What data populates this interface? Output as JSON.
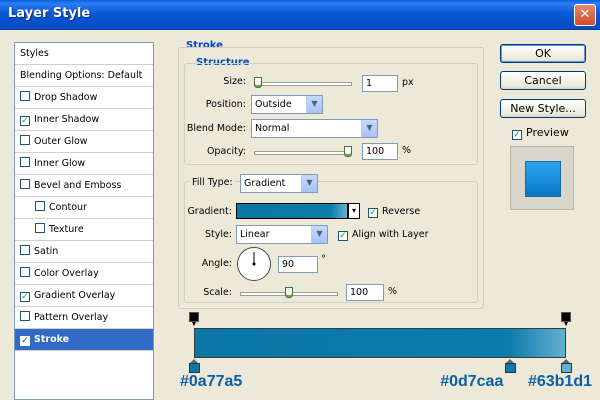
{
  "window": {
    "title": "Layer Style",
    "close_glyph": "✕"
  },
  "styles_list": {
    "header": "Styles",
    "blending": "Blending Options: Default",
    "items": [
      {
        "label": "Drop Shadow",
        "checked": false
      },
      {
        "label": "Inner Shadow",
        "checked": true
      },
      {
        "label": "Outer Glow",
        "checked": false
      },
      {
        "label": "Inner Glow",
        "checked": false
      },
      {
        "label": "Bevel and Emboss",
        "checked": false
      },
      {
        "label": "Contour",
        "checked": false
      },
      {
        "label": "Texture",
        "checked": false
      },
      {
        "label": "Satin",
        "checked": false
      },
      {
        "label": "Color Overlay",
        "checked": false
      },
      {
        "label": "Gradient Overlay",
        "checked": true
      },
      {
        "label": "Pattern Overlay",
        "checked": false
      },
      {
        "label": "Stroke",
        "checked": true
      }
    ],
    "check_glyph": "✓"
  },
  "stroke": {
    "title": "Stroke",
    "structure": {
      "title": "Structure",
      "size_label": "Size:",
      "size_value": "1",
      "size_unit": "px",
      "position_label": "Position:",
      "position_value": "Outside",
      "blend_label": "Blend Mode:",
      "blend_value": "Normal",
      "opacity_label": "Opacity:",
      "opacity_value": "100",
      "opacity_unit": "%",
      "size_level": 0.0,
      "opacity_level": 1.0
    },
    "fill": {
      "fill_type_label": "Fill Type:",
      "fill_type_value": "Gradient",
      "gradient_label": "Gradient:",
      "reverse_label": "Reverse",
      "reverse_checked": true,
      "style_label": "Style:",
      "style_value": "Linear",
      "align_label": "Align with Layer",
      "align_checked": true,
      "angle_label": "Angle:",
      "angle_value": "90",
      "angle_unit": "°",
      "scale_label": "Scale:",
      "scale_value": "100",
      "scale_unit": "%",
      "scale_level": 0.5
    }
  },
  "buttons": {
    "ok": "OK",
    "cancel": "Cancel",
    "new_style": "New Style...",
    "preview": "Preview",
    "preview_checked": true
  },
  "gradient_colors": {
    "c1": "#0a77a5",
    "c2": "#0d7caa",
    "c3": "#63b1d1"
  },
  "gradient_stops": [
    {
      "label": "#0a77a5",
      "color": "#0a77a5",
      "location": 0
    },
    {
      "label": "#0d7caa",
      "color": "#0d7caa",
      "location": 0.85
    },
    {
      "label": "#63b1d1",
      "color": "#63b1d1",
      "location": 1.0
    }
  ],
  "icons": {
    "arrow": "arrow-down",
    "dropdown_glyph": "▼",
    "small_dropdown_glyph": "▾"
  }
}
